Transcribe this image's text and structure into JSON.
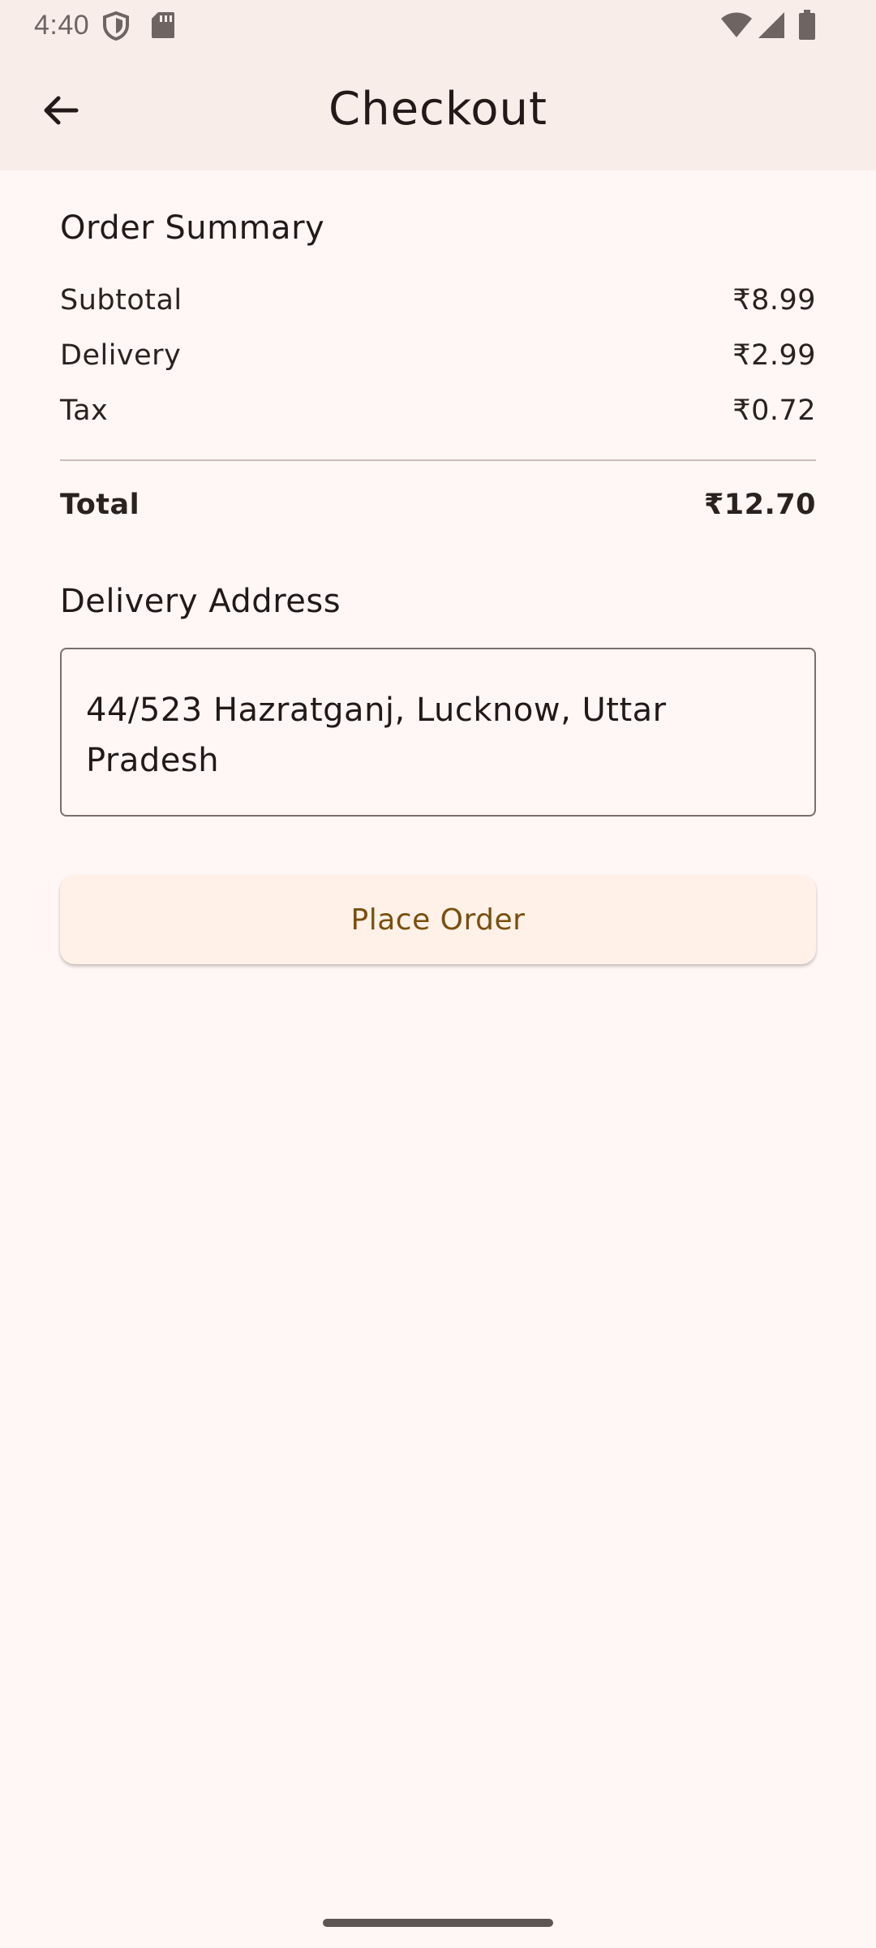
{
  "status_bar": {
    "time": "4:40",
    "icons": [
      "shield-icon",
      "sd-card-icon",
      "wifi-icon",
      "cellular-signal-icon",
      "battery-icon"
    ]
  },
  "app_bar": {
    "title": "Checkout",
    "back_icon": "arrow-back-icon"
  },
  "order_summary": {
    "title": "Order Summary",
    "rows": [
      {
        "label": "Subtotal",
        "value": "₹8.99"
      },
      {
        "label": "Delivery",
        "value": "₹2.99"
      },
      {
        "label": "Tax",
        "value": "₹0.72"
      }
    ],
    "total": {
      "label": "Total",
      "value": "₹12.70"
    }
  },
  "delivery": {
    "title": "Delivery Address",
    "address_value": "44/523 Hazratganj, Lucknow, Uttar Pradesh"
  },
  "actions": {
    "place_order_label": "Place Order"
  },
  "colors": {
    "background": "#fff7f5",
    "app_bar": "#f8ede9",
    "button_bg": "#fff1e8",
    "button_text": "#7a4f0d",
    "text": "#231919"
  }
}
